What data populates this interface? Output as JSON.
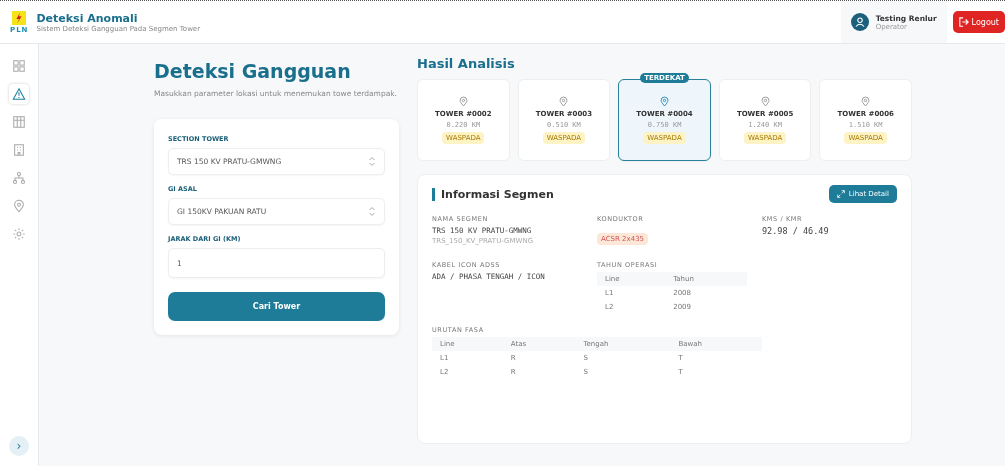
{
  "header": {
    "logo_text": "PLN",
    "title": "Deteksi Anomali",
    "subtitle": "Sistem Deteksi Gangguan Pada Segmen Tower",
    "user": {
      "name": "Testing Renlur",
      "role": "Operator"
    },
    "logout": "Logout"
  },
  "sidebar": {
    "items": [
      {
        "kind": "grid",
        "selected": false
      },
      {
        "kind": "alert",
        "selected": true
      },
      {
        "kind": "table",
        "selected": false
      },
      {
        "kind": "building",
        "selected": false
      },
      {
        "kind": "network",
        "selected": false
      },
      {
        "kind": "pin",
        "selected": false
      },
      {
        "kind": "gear",
        "selected": false
      }
    ],
    "expand": "›"
  },
  "form": {
    "title": "Deteksi Gangguan",
    "description": "Masukkan parameter lokasi untuk menemukan towe terdampak.",
    "fields": [
      {
        "kind": "select",
        "label": "SECTION TOWER",
        "value": "TRS 150 KV PRATU-GMWNG"
      },
      {
        "kind": "select",
        "label": "GI ASAL",
        "value": "GI 150KV PAKUAN RATU"
      },
      {
        "kind": "input",
        "label": "JARAK DARI GI (KM)",
        "value": "1"
      }
    ],
    "button": "Cari Tower"
  },
  "results": {
    "title": "Hasil Analisis",
    "towers": [
      {
        "name": "TOWER #0002",
        "distance": "0.220 KM",
        "status": "WASPADA",
        "selected": false
      },
      {
        "name": "TOWER #0003",
        "distance": "0.510 KM",
        "status": "WASPADA",
        "selected": false
      },
      {
        "name": "TOWER #0004",
        "distance": "0.750 KM",
        "status": "WASPADA",
        "selected": true,
        "badge": "TERDEKAT"
      },
      {
        "name": "TOWER #0005",
        "distance": "1.240 KM",
        "status": "WASPADA",
        "selected": false
      },
      {
        "name": "TOWER #0006",
        "distance": "1.510 KM",
        "status": "WASPADA",
        "selected": false
      }
    ]
  },
  "segment": {
    "title": "Informasi Segmen",
    "detail_button": "Lihat Detail",
    "nama_segmen": {
      "label": "NAMA SEGMEN",
      "value": "TRS 150 KV PRATU-GMWNG",
      "code": "TRS_150_KV_PRATU-GMWNG"
    },
    "konduktor": {
      "label": "KONDUKTOR",
      "value": "ACSR 2x435"
    },
    "kms_kmr": {
      "label": "KMS / KMR",
      "value": "92.98 / 46.49"
    },
    "kabel": {
      "label": "KABEL ICON ADSS",
      "value": "ADA / PHASA TENGAH / ICON"
    },
    "tahun_operasi": {
      "label": "TAHUN OPERASI",
      "columns": [
        "Line",
        "Tahun"
      ],
      "rows": [
        [
          "L1",
          "2008"
        ],
        [
          "L2",
          "2009"
        ]
      ]
    },
    "urutan_fasa": {
      "label": "URUTAN FASA",
      "columns": [
        "Line",
        "Atas",
        "Tengah",
        "Bawah"
      ],
      "rows": [
        [
          "L1",
          "R",
          "S",
          "T"
        ],
        [
          "L2",
          "R",
          "S",
          "T"
        ]
      ]
    }
  }
}
